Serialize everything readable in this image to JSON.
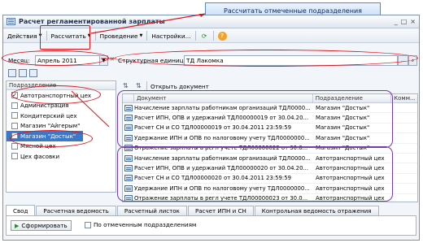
{
  "callout": {
    "text": "Рассчитать отмеченные подразделения"
  },
  "window": {
    "title": "Расчет регламентированной зарплаты"
  },
  "toolbar": {
    "actions": "Действия",
    "calculate": "Рассчитать",
    "posting": "Проведение",
    "settings": "Настройки..."
  },
  "filters": {
    "month_label": "Месяц:",
    "month_value": "Апрель 2011",
    "unit_label": "Структурная единица:",
    "unit_value": "ТД Лакомка"
  },
  "left": {
    "header": "Подразделение",
    "items": [
      {
        "label": "Автотранспортный цех",
        "checked": true
      },
      {
        "label": "Администрация",
        "checked": false
      },
      {
        "label": "Кондитерский цех",
        "checked": false
      },
      {
        "label": "Магазин \"Айгерым\"",
        "checked": false
      },
      {
        "label": "Магазин \"Достык\"",
        "checked": true
      },
      {
        "label": "Мясной цех",
        "checked": false
      },
      {
        "label": "Цех фасовки",
        "checked": false
      }
    ]
  },
  "grid": {
    "open_doc": "Открыть документ",
    "col_document": "Документ",
    "col_unit": "Подразделение",
    "col_comment": "Комм...",
    "rows": [
      {
        "doc": "Начисление зарплаты работникам организаций ТДЛ0000...",
        "unit": "Магазин \"Достык\""
      },
      {
        "doc": "Расчет ИПН, ОПВ и удержаний ТДЛ00000019 от 30.04.20...",
        "unit": "Магазин \"Достык\""
      },
      {
        "doc": "Расчет СН и СО ТДЛ00000019 от 30.04.2011 23:59:59",
        "unit": "Магазин \"Достык\""
      },
      {
        "doc": "Удержание ИПН и ОПВ по налоговому учету ТДЛ0000000...",
        "unit": "Магазин \"Достык\""
      },
      {
        "doc": "Отражение зарплаты в регл учете ТДЛ00000022 от 30.0...",
        "unit": "Магазин \"Достык\""
      },
      {
        "doc": "Начисление зарплаты работникам организаций ТДЛ0000...",
        "unit": "Автотранспортный цех"
      },
      {
        "doc": "Расчет ИПН, ОПВ и удержаний ТДЛ00000020 от 30.04.20...",
        "unit": "Автотранспортный цех"
      },
      {
        "doc": "Расчет СН и СО ТДЛ00000020 от 30.04.2011 23:59:59",
        "unit": "Автотранспортный цех"
      },
      {
        "doc": "Удержание ИПН и ОПВ по налоговому учету ТДЛ0000000...",
        "unit": "Автотранспортный цех"
      },
      {
        "doc": "Отражение зарплаты в регл учете ТДЛ00000023 от 30.0...",
        "unit": "Автотранспортный цех"
      }
    ]
  },
  "tabs": [
    "Свод",
    "Расчетная ведомость",
    "Расчетный листок",
    "Расчет ИПН и СН",
    "Контрольная ведомость отражения"
  ],
  "bottom": {
    "form_button": "Сформировать",
    "by_marked": "По отмеченным подразделениям"
  },
  "colors": {
    "annotation_red": "#d8141c",
    "annotation_purple": "#7a3aa6",
    "selection": "#3b78c8"
  }
}
